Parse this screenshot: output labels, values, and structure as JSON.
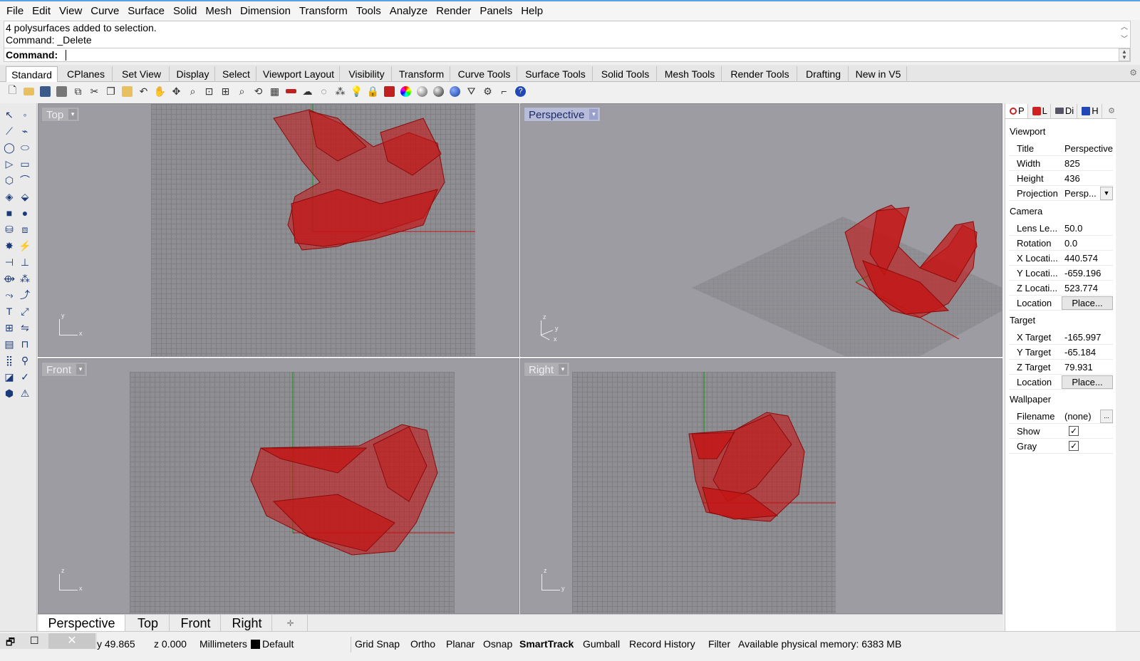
{
  "menu": [
    "File",
    "Edit",
    "View",
    "Curve",
    "Surface",
    "Solid",
    "Mesh",
    "Dimension",
    "Transform",
    "Tools",
    "Analyze",
    "Render",
    "Panels",
    "Help"
  ],
  "command": {
    "history_1": "4 polysurfaces added to selection.",
    "history_2": "Command: _Delete",
    "prompt": "Command:"
  },
  "toolbar_tabs": [
    "Standard",
    "CPlanes",
    "Set View",
    "Display",
    "Select",
    "Viewport Layout",
    "Visibility",
    "Transform",
    "Curve Tools",
    "Surface Tools",
    "Solid Tools",
    "Mesh Tools",
    "Render Tools",
    "Drafting",
    "New in V5"
  ],
  "active_toolbar_tab": "Standard",
  "viewports": {
    "top": {
      "label": "Top"
    },
    "perspective": {
      "label": "Perspective"
    },
    "front": {
      "label": "Front"
    },
    "right": {
      "label": "Right"
    }
  },
  "viewport_tabs": [
    "Perspective",
    "Top",
    "Front",
    "Right"
  ],
  "active_viewport_tab": "Perspective",
  "panel": {
    "tabs": [
      "P",
      "L",
      "Di",
      "H"
    ],
    "viewport_section": "Viewport",
    "title_label": "Title",
    "title_value": "Perspective",
    "width_label": "Width",
    "width_value": "825",
    "height_label": "Height",
    "height_value": "436",
    "projection_label": "Projection",
    "projection_value": "Persp...",
    "camera_section": "Camera",
    "lens_label": "Lens Le...",
    "lens_value": "50.0",
    "rotation_label": "Rotation",
    "rotation_value": "0.0",
    "xloc_label": "X Locati...",
    "xloc_value": "440.574",
    "yloc_label": "Y Locati...",
    "yloc_value": "-659.196",
    "zloc_label": "Z Locati...",
    "zloc_value": "523.774",
    "location_label": "Location",
    "place_button": "Place...",
    "target_section": "Target",
    "xtarget_label": "X Target",
    "xtarget_value": "-165.997",
    "ytarget_label": "Y Target",
    "ytarget_value": "-65.184",
    "ztarget_label": "Z Target",
    "ztarget_value": "79.931",
    "target_location_label": "Location",
    "target_place_button": "Place...",
    "wallpaper_section": "Wallpaper",
    "filename_label": "Filename",
    "filename_value": "(none)",
    "filename_button": "...",
    "show_label": "Show",
    "show_checked": true,
    "gray_label": "Gray",
    "gray_checked": true
  },
  "status": {
    "y": "y 49.865",
    "z": "z 0.000",
    "units": "Millimeters",
    "layer": "Default",
    "grid_snap": "Grid Snap",
    "ortho": "Ortho",
    "planar": "Planar",
    "osnap": "Osnap",
    "smarttrack": "SmartTrack",
    "gumball": "Gumball",
    "record_history": "Record History",
    "filter": "Filter",
    "memory": "Available physical memory: 6383 MB"
  },
  "colors": {
    "object": "#c41414",
    "viewport_bg": "#9c9ca2",
    "grid": "#8f8f93",
    "x_axis": "#c01010",
    "y_axis": "#109010"
  }
}
